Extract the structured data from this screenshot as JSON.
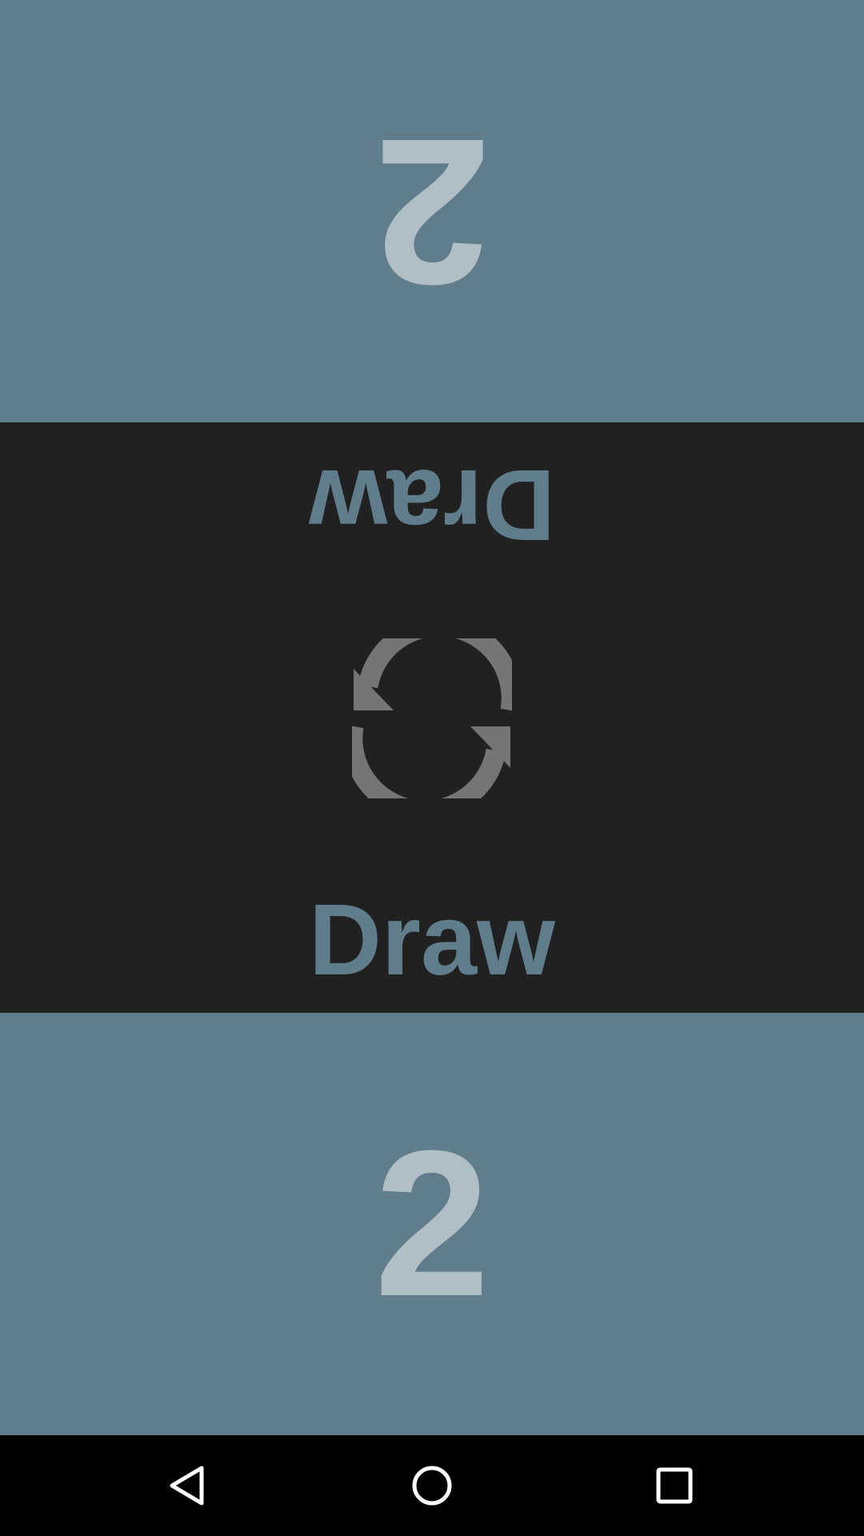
{
  "colors": {
    "score_panel_bg": "#607d8b",
    "score_text": "#b0bec5",
    "middle_bg": "#212121",
    "status_text": "#607d8b",
    "reset_icon": "#757575",
    "navbar_bg": "#000000",
    "navbar_icon": "#ffffff"
  },
  "top_player": {
    "score": "2"
  },
  "bottom_player": {
    "score": "2"
  },
  "status": {
    "top_text": "Draw",
    "bottom_text": "Draw"
  },
  "icons": {
    "reset": "refresh-icon",
    "back": "back-triangle-icon",
    "home": "home-circle-icon",
    "recents": "recents-square-icon"
  }
}
